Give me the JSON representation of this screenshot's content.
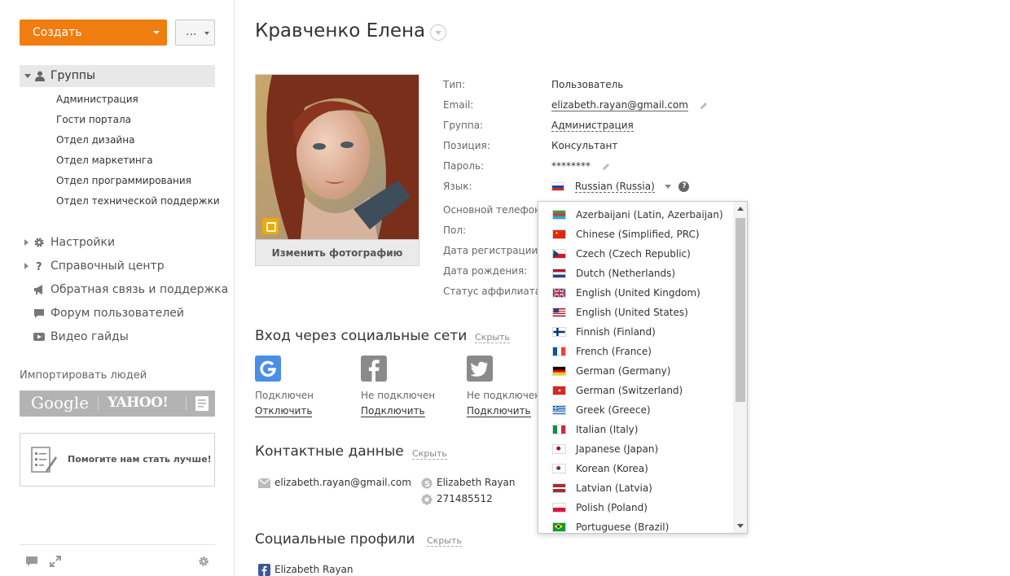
{
  "toolbar": {
    "create_label": "Создать",
    "more_label": "..."
  },
  "sidebar": {
    "groups_label": "Группы",
    "groups": [
      "Администрация",
      "Гости портала",
      "Отдел дизайна",
      "Отдел маркетинга",
      "Отдел программирования",
      "Отдел технической поддержки"
    ],
    "nav": [
      {
        "label": "Настройки",
        "icon": "gear-icon"
      },
      {
        "label": "Справочный центр",
        "icon": "question-icon"
      },
      {
        "label": "Обратная связь и поддержка",
        "icon": "megaphone-icon"
      },
      {
        "label": "Форум пользователей",
        "icon": "chat-icon"
      },
      {
        "label": "Видео гайды",
        "icon": "video-icon"
      }
    ],
    "import_label": "Импортировать людей",
    "import_google": "Google",
    "import_yahoo": "YAHOO!",
    "help_text": "Помогите нам стать лучше!"
  },
  "profile": {
    "name": "Кравченко Елена",
    "change_photo": "Изменить фотографию",
    "fields": {
      "type_label": "Тип:",
      "type_value": "Пользователь",
      "email_label": "Email:",
      "email_value": "elizabeth.rayan@gmail.com",
      "group_label": "Группа:",
      "group_value": "Администрация",
      "position_label": "Позиция:",
      "position_value": "Консультант",
      "password_label": "Пароль:",
      "password_value": "********",
      "language_label": "Язык:",
      "language_value": "Russian (Russia)",
      "phone_label": "Основной телефон:",
      "sex_label": "Пол:",
      "reg_label": "Дата регистрации:",
      "birth_label": "Дата рождения:",
      "affiliate_label": "Статус аффилиата:"
    }
  },
  "social_login": {
    "title": "Вход через социальные сети",
    "hide": "Скрыть",
    "items": [
      {
        "state": "Подключен",
        "action": "Отключить",
        "icon": "google-icon",
        "color": "#4a8ee6"
      },
      {
        "state": "Не подключен",
        "action": "Подключить",
        "icon": "facebook-icon",
        "color": "#8a8a8a"
      },
      {
        "state": "Не подключен",
        "action": "Подключить",
        "icon": "twitter-icon",
        "color": "#8a8a8a"
      }
    ]
  },
  "contacts": {
    "title": "Контактные данные",
    "hide": "Скрыть",
    "email": "elizabeth.rayan@gmail.com",
    "skype": "Elizabeth Rayan",
    "icq": "271485512"
  },
  "social_profiles": {
    "title": "Социальные профили",
    "hide": "Скрыть",
    "facebook": "Elizabeth Rayan"
  },
  "language_dropdown": {
    "options": [
      "Azerbaijani (Latin, Azerbaijan)",
      "Chinese (Simplified, PRC)",
      "Czech (Czech Republic)",
      "Dutch (Netherlands)",
      "English (United Kingdom)",
      "English (United States)",
      "Finnish (Finland)",
      "French (France)",
      "German (Germany)",
      "German (Switzerland)",
      "Greek (Greece)",
      "Italian (Italy)",
      "Japanese (Japan)",
      "Korean (Korea)",
      "Latvian (Latvia)",
      "Polish (Poland)",
      "Portuguese (Brazil)"
    ]
  },
  "colors": {
    "accent": "#f07d0f"
  }
}
